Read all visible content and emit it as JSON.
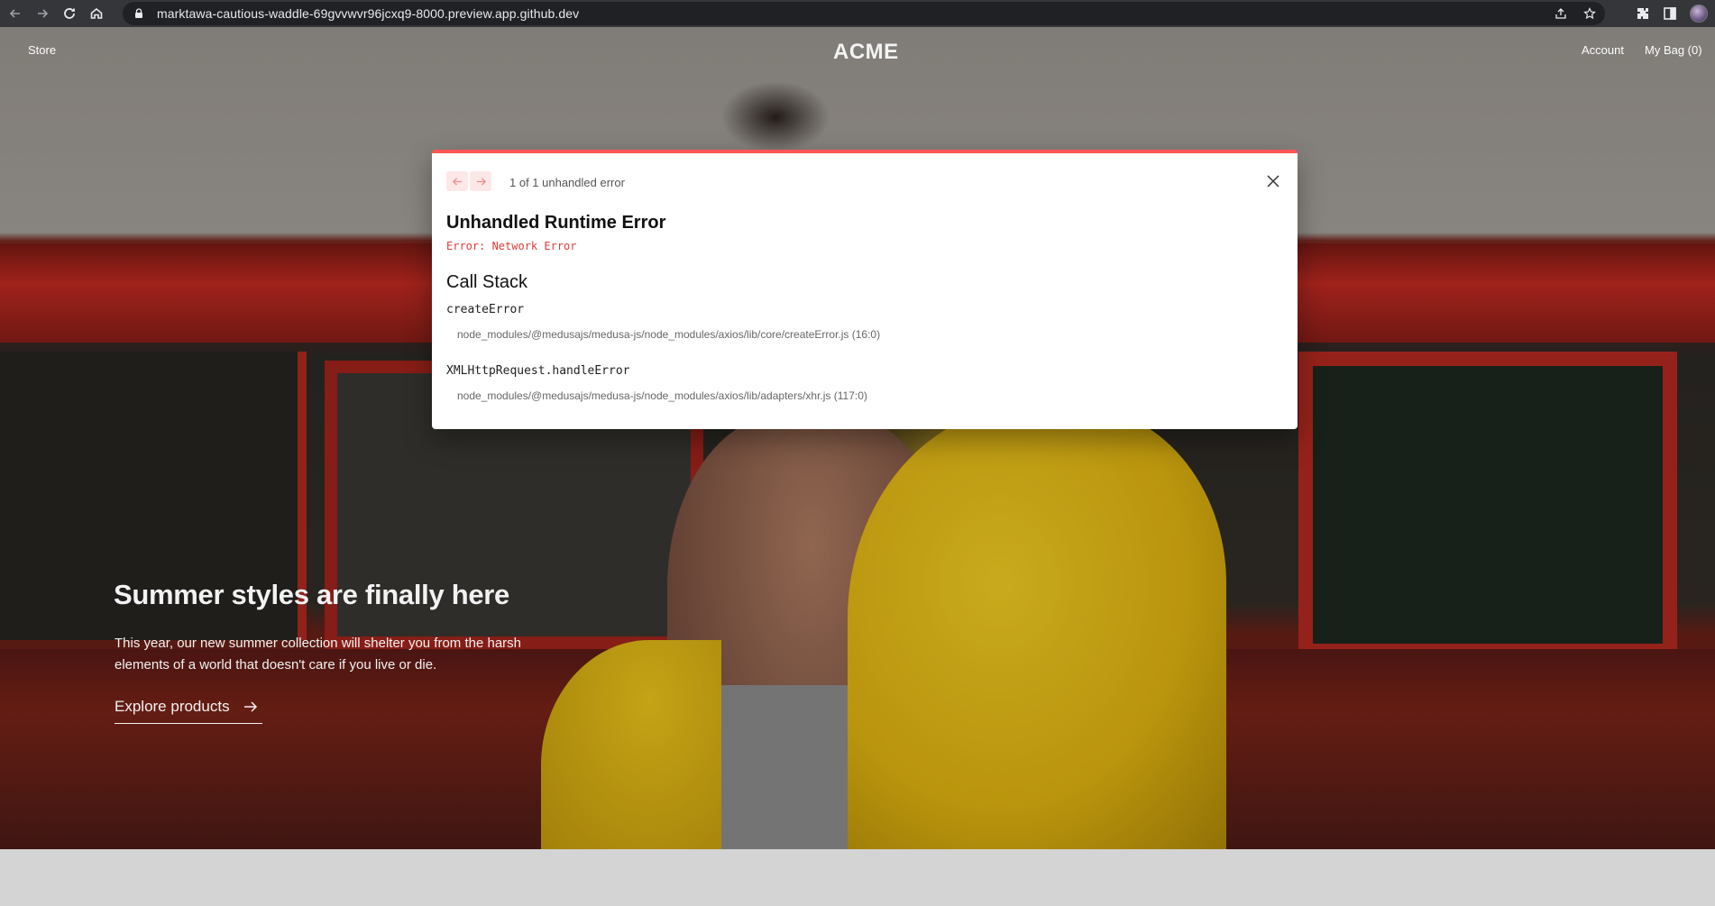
{
  "browser": {
    "url": "marktawa-cautious-waddle-69gvvwvr96jcxq9-8000.preview.app.github.dev",
    "icons": [
      "back-icon",
      "forward-icon",
      "reload-icon",
      "home-icon",
      "lock-icon",
      "share-icon",
      "star-icon",
      "extensions-icon",
      "sidepanel-icon",
      "profile-avatar"
    ]
  },
  "header": {
    "store": "Store",
    "logo": "ACME",
    "account": "Account",
    "bag": "My Bag (0)"
  },
  "hero": {
    "title": "Summer styles are finally here",
    "description": "This year, our new summer collection will shelter you from the harsh elements of a world that doesn't care if you live or die.",
    "cta": "Explore products"
  },
  "error_overlay": {
    "count": "1 of 1 unhandled error",
    "title": "Unhandled Runtime Error",
    "message": "Error: Network Error",
    "stack_title": "Call Stack",
    "frames": [
      {
        "name": "createError",
        "file": "node_modules/@medusajs/medusa-js/node_modules/axios/lib/core/createError.js (16:0)"
      },
      {
        "name": "XMLHttpRequest.handleError",
        "file": "node_modules/@medusajs/medusa-js/node_modules/axios/lib/adapters/xhr.js (117:0)"
      }
    ],
    "accent_color": "#ff5555"
  }
}
